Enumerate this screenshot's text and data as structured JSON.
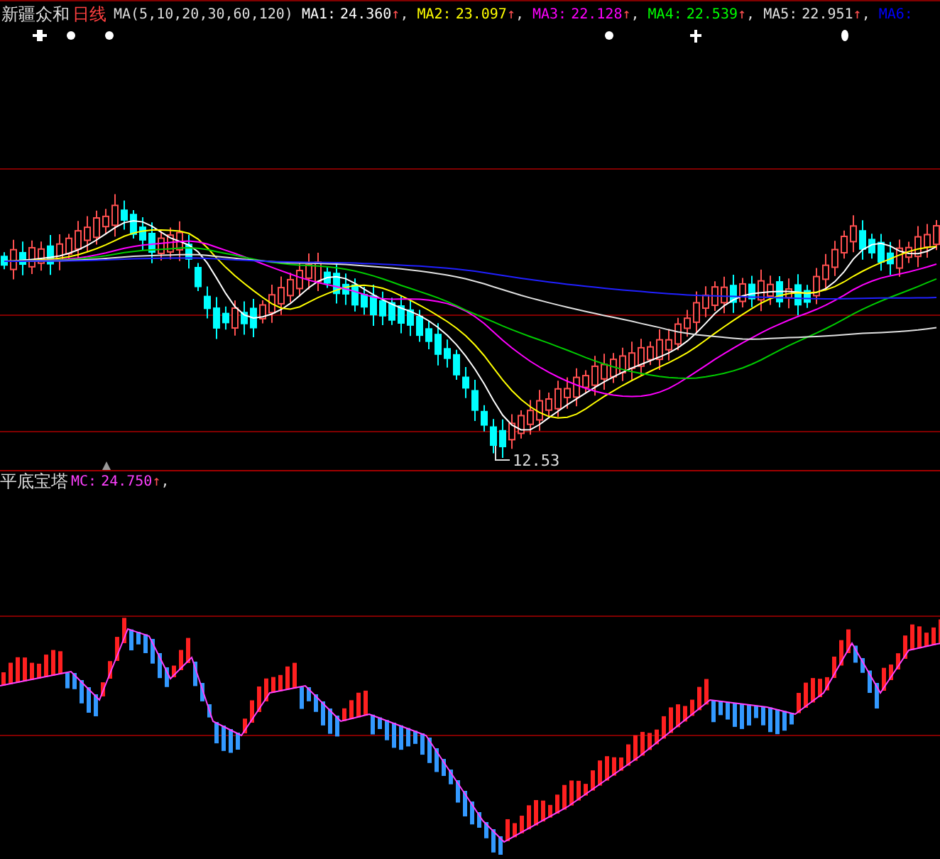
{
  "price_panel": {
    "stock_name": "新疆众和",
    "period": "日线",
    "indicator": "MA(5,10,20,30,60,120)",
    "readings": [
      {
        "label": "MA1:",
        "value": "24.360",
        "arrow": "↑",
        "separator": ",",
        "color": "#ffffff"
      },
      {
        "label": "MA2:",
        "value": "23.097",
        "arrow": "↑",
        "separator": ",",
        "color": "#ffff00"
      },
      {
        "label": "MA3:",
        "value": "22.128",
        "arrow": "↑",
        "separator": ",",
        "color": "#ff00ff"
      },
      {
        "label": "MA4:",
        "value": "22.539",
        "arrow": "↑",
        "separator": ",",
        "color": "#00ff00"
      },
      {
        "label": "MA5:",
        "value": "22.951",
        "arrow": "↑",
        "separator": ",",
        "color": "#e0e0e0"
      },
      {
        "label": "MA6:",
        "color": "#0000ff"
      }
    ],
    "low_label": "12.53"
  },
  "indicator_panel": {
    "name": "平底宝塔",
    "readings": [
      {
        "label": "MC:",
        "value": "24.750",
        "arrow": "↑",
        "separator": ",",
        "color": "#ff40ff"
      }
    ]
  }
}
